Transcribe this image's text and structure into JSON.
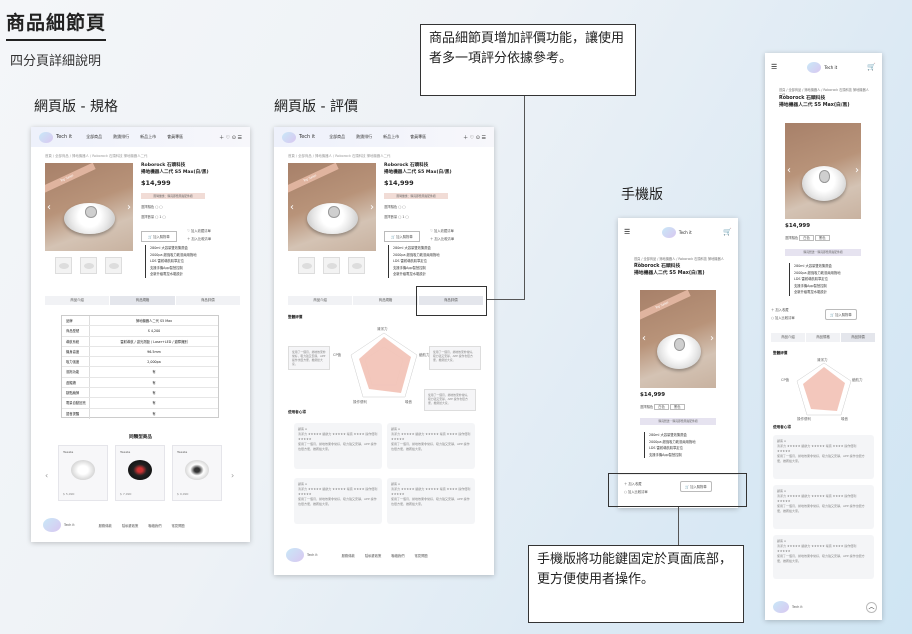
{
  "title": "商品細節頁",
  "subtitle": "四分頁詳細說明",
  "sections": {
    "web_spec": "網頁版 - 規格",
    "web_review": "網頁版 - 評價",
    "mobile": "手機版"
  },
  "callouts": {
    "review": "商品細節頁增加評價功能，讓使用者多一項評分依據參考。",
    "mobile": "手機版將功能鍵固定於頁面底部，更方便使用者操作。"
  },
  "nav": {
    "logo": "Tech it",
    "links": [
      "全部商品",
      "熱銷排行",
      "新品上市",
      "會員專區"
    ],
    "icons": "＋ ♡ ⊙ ☰"
  },
  "product": {
    "crumb": "首頁 / 全部商品 / 掃地機器人 / Roborock 石頭科技 掃地機器人二代",
    "brand": "Roborock 石頭科技",
    "name": "掃地機器人二代 S5 Max(白/黑)",
    "price": "$14,999",
    "tag": "Top Sales",
    "promo": "限時優惠：購買即贈原廠配件組",
    "opt_color": "選擇顏色",
    "opt_qty": "選擇數量",
    "add_cart": "加入購物車",
    "fav": "加入收藏清單",
    "compare": "加入比較清單",
    "features": [
      "280ml 大容量雙效集塵盒",
      "2000pa 超強吸力乾濕兩用拖地",
      "LDS 雷射導航精準定位",
      "支援手機App智慧控制",
      "全新升級電控水箱設計"
    ]
  },
  "tabs": [
    "商品介紹",
    "商品規格",
    "商品評價"
  ],
  "spec": {
    "header": [
      "品牌",
      "掃地機器人二代 S5 Max"
    ],
    "rows": [
      [
        "商品型號",
        "S 4,200"
      ],
      [
        "導航系統",
        "雷射導航 / 激光測距 / Laser+LED / 避障識別"
      ],
      [
        "機身高度",
        "96.5mm"
      ],
      [
        "吸力強度",
        "2,000pa"
      ],
      [
        "濕拖功能",
        "有"
      ],
      [
        "虛擬牆",
        "有"
      ],
      [
        "斷點續掃",
        "有"
      ],
      [
        "電量自動回充",
        "有"
      ],
      [
        "語音提醒",
        "有"
      ]
    ]
  },
  "recommend": {
    "title": "同類型商品",
    "items": [
      {
        "brand": "Tessla",
        "name": "掃地機器人",
        "price": "$ 5,990"
      },
      {
        "brand": "Tessla",
        "name": "掃地機器人",
        "price": "$ 7,990"
      },
      {
        "brand": "Tessla",
        "name": "掃地機器人",
        "price": "$ 9,990"
      }
    ],
    "more": "商品詳情"
  },
  "footer": {
    "logo": "Tech it",
    "links": [
      "服務條款",
      "隱私權政策",
      "聯絡我們",
      "常見問題"
    ],
    "copy": "© Tech it 2024 All Rights Reserved"
  },
  "review": {
    "score_title": "整體評價",
    "radar_labels": [
      "清潔力",
      "續航力",
      "噪音",
      "操作便利",
      "CP值"
    ],
    "comment_title": "使用者心得",
    "reviewer": "顧客 A",
    "stars": "★★★★★",
    "summary": "清潔力 ★★★★★ 續航力 ★★★★★ 噪音 ★★★★ 操作便利 ★★★★★",
    "body": "使用了一個月，掃地效果非常好，吸力強又安靜，APP 操作也很方便，推薦給大家。"
  },
  "mobile": {
    "logo": "Tech it",
    "menu": "☰",
    "cart": "🛒",
    "fav": "加入收藏",
    "compare": "加入比較清單",
    "cart_btn": "加入購物車",
    "promo": "購買贈送・購買即贈原廠配件組",
    "tabs": [
      "商品介紹",
      "商品規格",
      "商品評價"
    ],
    "opt_color": "選擇顏色",
    "opt_white": "白色",
    "opt_black": "黑色"
  },
  "colors": {
    "accent": "#f1dcd6",
    "photo": "#a78069",
    "radar": "#f2c1b5"
  }
}
